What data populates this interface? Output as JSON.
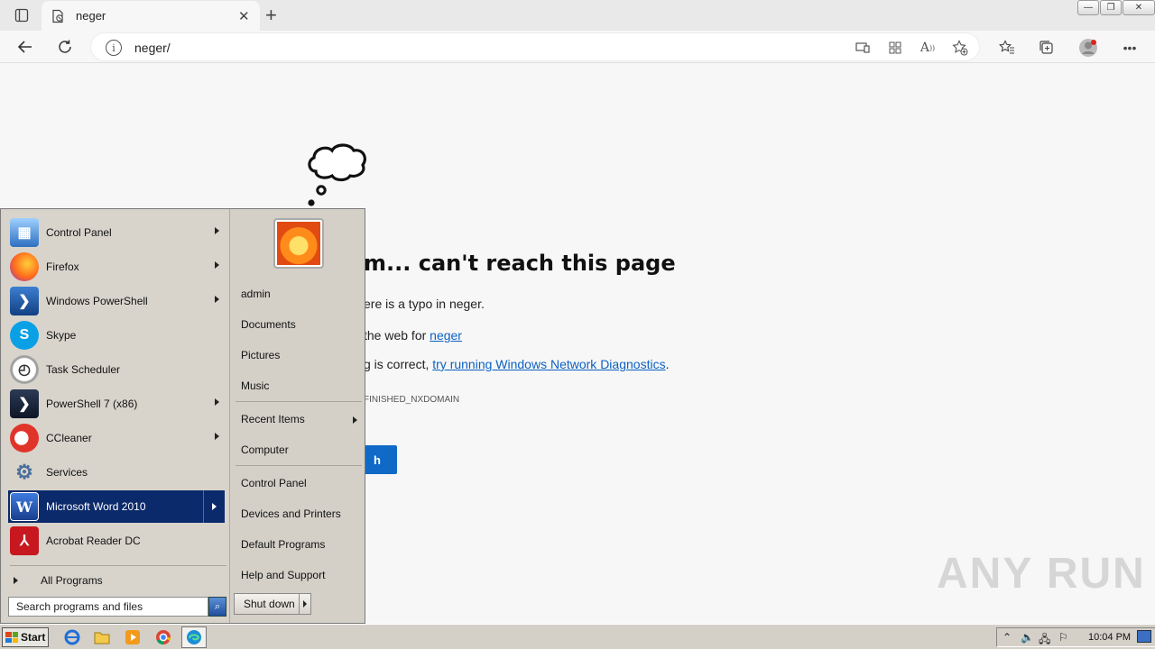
{
  "browser": {
    "tab_title": "neger",
    "address": "neger/",
    "window_controls": [
      "minimize",
      "restore",
      "close"
    ]
  },
  "error_page": {
    "title": "m... can't reach this page",
    "line1": "ere is a typo in neger.",
    "line2_prefix": "the web for ",
    "line2_link": "neger",
    "line3_prefix": "g is correct, ",
    "line3_link": "try running Windows Network Diagnostics",
    "line3_suffix": ".",
    "error_code": "FINISHED_NXDOMAIN",
    "button_label": "h"
  },
  "start_menu": {
    "programs": [
      {
        "label": "Control Panel",
        "icon": "control-panel-icon",
        "submenu": true
      },
      {
        "label": "Firefox",
        "icon": "firefox-icon",
        "submenu": true
      },
      {
        "label": "Windows PowerShell",
        "icon": "powershell-icon",
        "submenu": true
      },
      {
        "label": "Skype",
        "icon": "skype-icon",
        "submenu": false
      },
      {
        "label": "Task Scheduler",
        "icon": "clock-icon",
        "submenu": false
      },
      {
        "label": "PowerShell 7 (x86)",
        "icon": "powershell7-icon",
        "submenu": true
      },
      {
        "label": "CCleaner",
        "icon": "ccleaner-icon",
        "submenu": true
      },
      {
        "label": "Services",
        "icon": "gears-icon",
        "submenu": false
      },
      {
        "label": "Microsoft Word 2010",
        "icon": "word-icon",
        "submenu": true,
        "selected": true
      },
      {
        "label": "Acrobat Reader DC",
        "icon": "acrobat-icon",
        "submenu": false
      }
    ],
    "all_programs": "All Programs",
    "search_placeholder": "Search programs and files",
    "right": {
      "user": "admin",
      "documents": "Documents",
      "pictures": "Pictures",
      "music": "Music",
      "recent_items": "Recent Items",
      "computer": "Computer",
      "control_panel": "Control Panel",
      "devices_printers": "Devices and Printers",
      "default_programs": "Default Programs",
      "help_support": "Help and Support",
      "shut_down": "Shut down"
    }
  },
  "taskbar": {
    "start_label": "Start",
    "clock": "10:04 PM"
  },
  "watermark": "ANY RUN"
}
